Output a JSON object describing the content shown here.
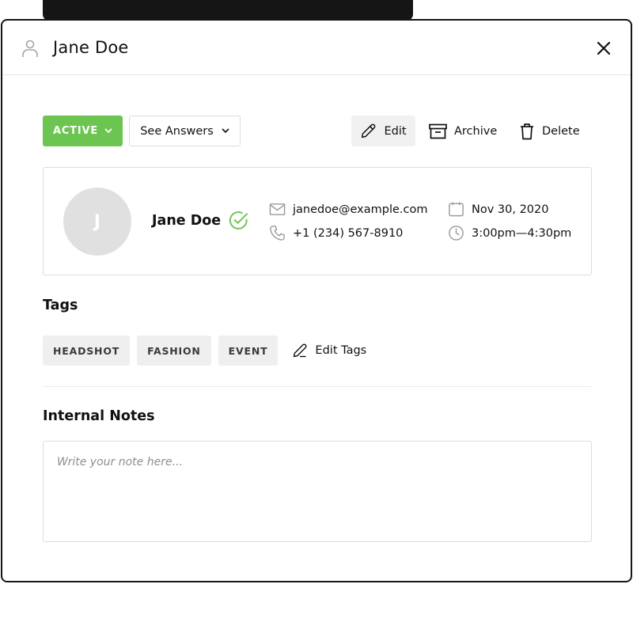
{
  "modal": {
    "title": "Jane Doe"
  },
  "toolbar": {
    "status_label": "ACTIVE",
    "answers_label": "See Answers",
    "edit_label": "Edit",
    "archive_label": "Archive",
    "delete_label": "Delete"
  },
  "contact": {
    "initial": "J",
    "name": "Jane Doe",
    "email": "janedoe@example.com",
    "phone": "+1 (234) 567-8910",
    "date": "Nov 30, 2020",
    "time": "3:00pm—4:30pm"
  },
  "tags": {
    "title": "Tags",
    "items": [
      "HEADSHOT",
      "FASHION",
      "EVENT"
    ],
    "edit_label": "Edit Tags"
  },
  "notes": {
    "title": "Internal Notes",
    "placeholder": "Write your note here...",
    "value": ""
  },
  "colors": {
    "accent_green": "#6cc551",
    "border": "#dddddd",
    "chip_bg": "#efefef",
    "dark": "#151515"
  },
  "icons": {
    "header": "user-icon",
    "close": "close-icon",
    "status": "chevron-down-icon",
    "answers": "chevron-down-icon",
    "edit": "pencil-icon",
    "archive": "archive-box-icon",
    "delete": "trash-icon",
    "verified": "check-circle-icon",
    "email": "mail-icon",
    "phone": "phone-icon",
    "date": "calendar-icon",
    "time": "clock-icon",
    "edit_tags": "pencil-icon"
  }
}
